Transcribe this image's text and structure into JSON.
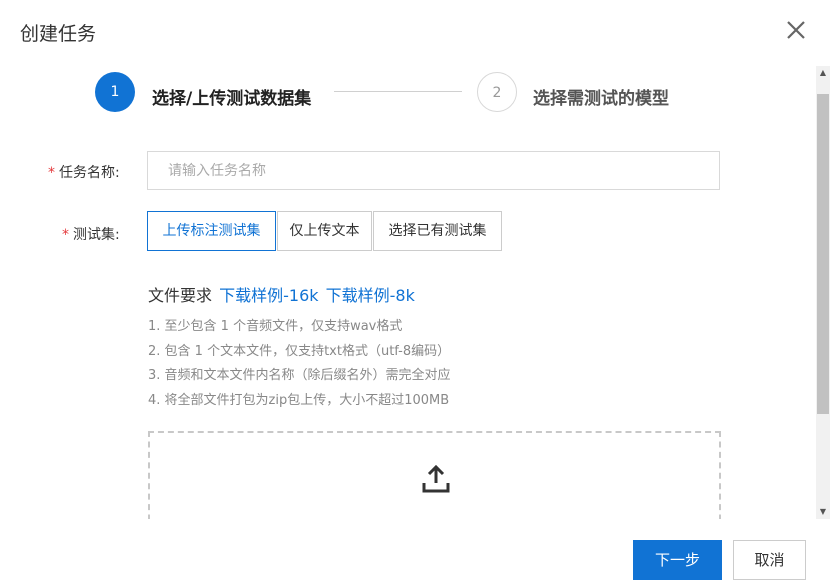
{
  "dialog": {
    "title": "创建任务",
    "close_icon": "close-icon"
  },
  "steps": [
    {
      "number": "1",
      "label": "选择/上传测试数据集",
      "active": true
    },
    {
      "number": "2",
      "label": "选择需测试的模型",
      "active": false
    }
  ],
  "form": {
    "required_mark": "*",
    "task_name_label": "任务名称:",
    "task_name_placeholder": "请输入任务名称",
    "task_name_value": "",
    "test_set_label": "测试集:",
    "test_set_options": [
      "上传标注测试集",
      "仅上传文本",
      "选择已有测试集"
    ],
    "test_set_selected": "上传标注测试集"
  },
  "requirements": {
    "title": "文件要求",
    "links": [
      "下载样例-16k",
      "下载样例-8k"
    ],
    "items": [
      "1. 至少包含 1 个音频文件，仅支持wav格式",
      "2. 包含 1 个文本文件，仅支持txt格式（utf-8编码）",
      "3. 音频和文本文件内名称（除后缀名外）需完全对应",
      "4. 将全部文件打包为zip包上传，大小不超过100MB"
    ]
  },
  "upload": {
    "icon": "upload-icon"
  },
  "buttons": {
    "next": "下一步",
    "cancel": "取消"
  },
  "colors": {
    "accent": "#1173d4",
    "required": "#e4393c"
  }
}
